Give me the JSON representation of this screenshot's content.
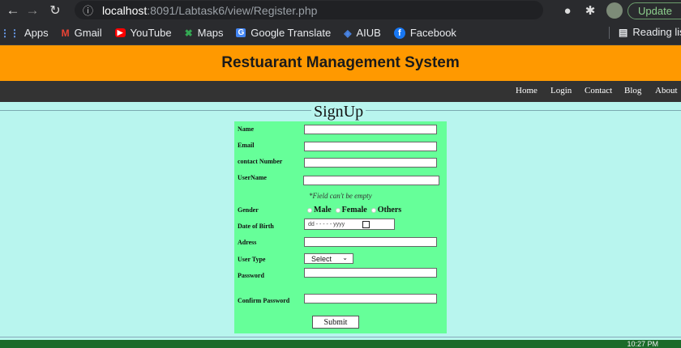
{
  "browser": {
    "url_host": "localhost",
    "url_path": ":8091/Labtask6/view/Register.php",
    "update_label": "Update",
    "bookmarks": [
      {
        "label": "Apps",
        "icon": "apps-icon"
      },
      {
        "label": "Gmail",
        "icon": "gmail-icon"
      },
      {
        "label": "YouTube",
        "icon": "youtube-icon"
      },
      {
        "label": "Maps",
        "icon": "maps-icon"
      },
      {
        "label": "Google Translate",
        "icon": "translate-icon"
      },
      {
        "label": "AIUB",
        "icon": "aiub-icon"
      },
      {
        "label": "Facebook",
        "icon": "facebook-icon"
      }
    ],
    "reading_list": "Reading lis"
  },
  "page": {
    "banner_title": "Restuarant Management System",
    "banner_color": "#ff9900",
    "nav": [
      {
        "label": "Home"
      },
      {
        "label": "Login"
      },
      {
        "label": "Contact"
      },
      {
        "label": "Blog"
      },
      {
        "label": "About"
      }
    ],
    "form_legend": "SignUp",
    "form_bg": "#66ff99",
    "fields": {
      "name": "Name",
      "email": "Email",
      "contact": "contact Number",
      "username": "UserName",
      "note": "*Field can't be empty",
      "gender": "Gender",
      "gender_options": [
        "Male",
        "Female",
        "Others"
      ],
      "dob": "Date of Birth",
      "dob_placeholder": "dd - - - - - yyyy",
      "address": "Adress",
      "user_type": "User Type",
      "user_type_selected": "Select",
      "password": "Password",
      "confirm_password": "Confirm Password"
    },
    "submit_label": "Submit"
  },
  "taskbar": {
    "time": "10:27 PM"
  }
}
